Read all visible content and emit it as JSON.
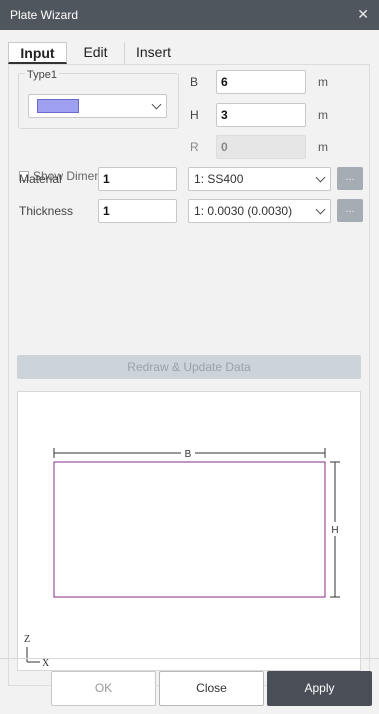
{
  "window": {
    "title": "Plate Wizard",
    "close_glyph": "✕"
  },
  "tabs": [
    {
      "label": "Input",
      "active": true
    },
    {
      "label": "Edit",
      "active": false
    },
    {
      "label": "Insert",
      "active": false
    }
  ],
  "type_group": {
    "label": "Type1",
    "swatch_color": "#a0a0f0"
  },
  "dimensions": {
    "b": {
      "label": "B",
      "value": "6",
      "unit": "m"
    },
    "h": {
      "label": "H",
      "value": "3",
      "unit": "m"
    },
    "r": {
      "label": "R",
      "value": "0",
      "unit": "m",
      "disabled": true
    }
  },
  "show_dimensions": {
    "label": "Show Dimensions",
    "checked": false
  },
  "material": {
    "label": "Material",
    "value": "1",
    "selected": "1: SS400",
    "more": "..."
  },
  "thickness": {
    "label": "Thickness",
    "value": "1",
    "selected": "1: 0.0030 (0.0030)",
    "more": "..."
  },
  "redraw_button": "Redraw & Update Data",
  "preview": {
    "width_label": "B",
    "height_label": "H",
    "axis_z": "Z",
    "axis_x": "X",
    "plate_color": "#8a2a8a"
  },
  "footer": {
    "ok": "OK",
    "close": "Close",
    "apply": "Apply"
  }
}
